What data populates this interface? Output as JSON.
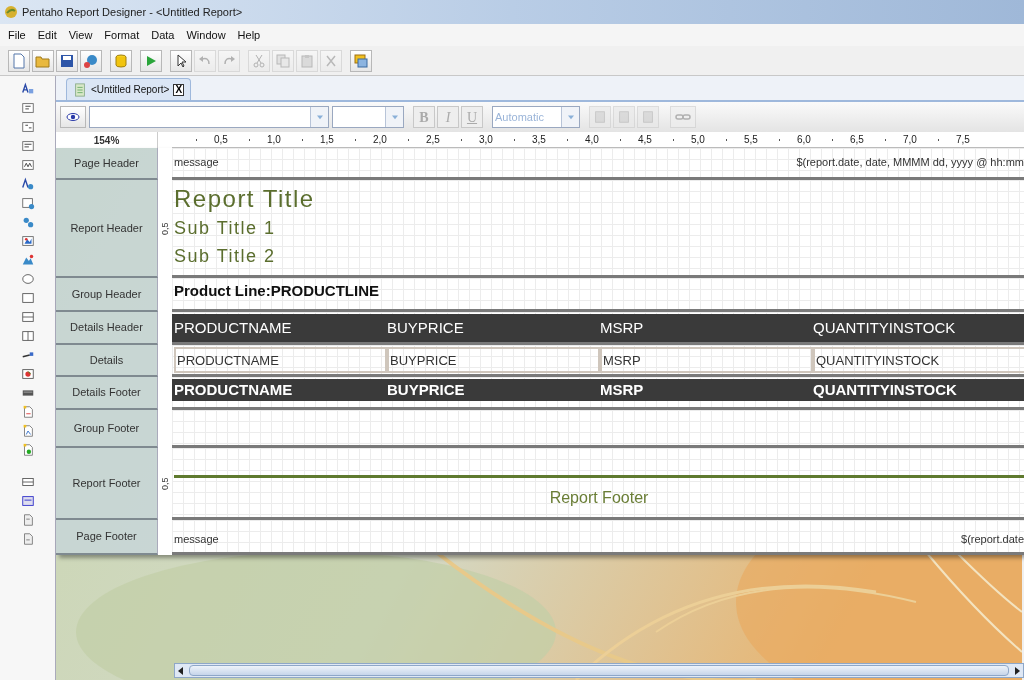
{
  "window": {
    "title": "Pentaho Report Designer - <Untitled Report>"
  },
  "menu": [
    "File",
    "Edit",
    "View",
    "Format",
    "Data",
    "Window",
    "Help"
  ],
  "toolbar_groups": [
    {
      "buttons": [
        {
          "kind": "new",
          "disabled": false
        },
        {
          "kind": "open",
          "disabled": false
        },
        {
          "kind": "save",
          "disabled": false
        },
        {
          "kind": "publish",
          "disabled": false
        }
      ]
    },
    {
      "buttons": [
        {
          "kind": "datasource",
          "disabled": false
        }
      ]
    },
    {
      "buttons": [
        {
          "kind": "run",
          "disabled": false
        }
      ]
    },
    {
      "buttons": [
        {
          "kind": "select",
          "disabled": false
        },
        {
          "kind": "undo",
          "disabled": true
        },
        {
          "kind": "redo",
          "disabled": true
        }
      ]
    },
    {
      "buttons": [
        {
          "kind": "cut",
          "disabled": true
        },
        {
          "kind": "copy",
          "disabled": true
        },
        {
          "kind": "paste",
          "disabled": true
        },
        {
          "kind": "delete",
          "disabled": true
        }
      ]
    },
    {
      "buttons": [
        {
          "kind": "layout",
          "disabled": false
        }
      ]
    }
  ],
  "tabs": [
    {
      "label": "<Untitled Report>",
      "selected": true,
      "close": "X"
    }
  ],
  "format_bar": {
    "styles": [
      {
        "label": "B",
        "disabled": true
      },
      {
        "label": "I",
        "disabled": true
      },
      {
        "label": "U",
        "disabled": true
      }
    ],
    "color": {
      "value": "Automatic",
      "disabled": true
    },
    "align_buttons": [
      {
        "disabled": true
      },
      {
        "disabled": true
      },
      {
        "disabled": true
      }
    ],
    "link_button": {
      "disabled": true
    }
  },
  "ruler": {
    "zoom": "154%",
    "marks": [
      "0,5",
      "1,0",
      "1,5",
      "2,0",
      "2,5",
      "3,0",
      "3,5",
      "4,0",
      "4,5",
      "5,0",
      "5,5",
      "6,0",
      "6,5",
      "7,0",
      "7,5"
    ]
  },
  "bands": [
    {
      "kind": "page_header",
      "label": "Page Header",
      "left": "message",
      "right": "$(report.date, date, MMMM dd, yyyy @ hh:mm"
    },
    {
      "kind": "report_header",
      "label": "Report Header",
      "ruler_mark": "0,5",
      "title": "Report Title",
      "subtitles": [
        "Sub Title 1",
        "Sub Title 2"
      ]
    },
    {
      "kind": "group_header",
      "label": "Group Header",
      "text": "Product Line:PRODUCTLINE"
    },
    {
      "kind": "details_header",
      "label": "Details Header",
      "fields": [
        "PRODUCTNAME",
        "BUYPRICE",
        "MSRP",
        "QUANTITYINSTOCK"
      ]
    },
    {
      "kind": "details",
      "label": "Details",
      "fields": [
        "PRODUCTNAME",
        "BUYPRICE",
        "MSRP",
        "QUANTITYINSTOCK"
      ]
    },
    {
      "kind": "details_footer",
      "label": "Details Footer",
      "fields": [
        "PRODUCTNAME",
        "BUYPRICE",
        "MSRP",
        "QUANTITYINSTOCK"
      ]
    },
    {
      "kind": "group_footer",
      "label": "Group Footer"
    },
    {
      "kind": "report_footer",
      "label": "Report Footer",
      "ruler_mark": "0,5",
      "text": "Report Footer"
    },
    {
      "kind": "page_footer",
      "label": "Page Footer",
      "left": "message",
      "right": "$(report.date"
    }
  ]
}
